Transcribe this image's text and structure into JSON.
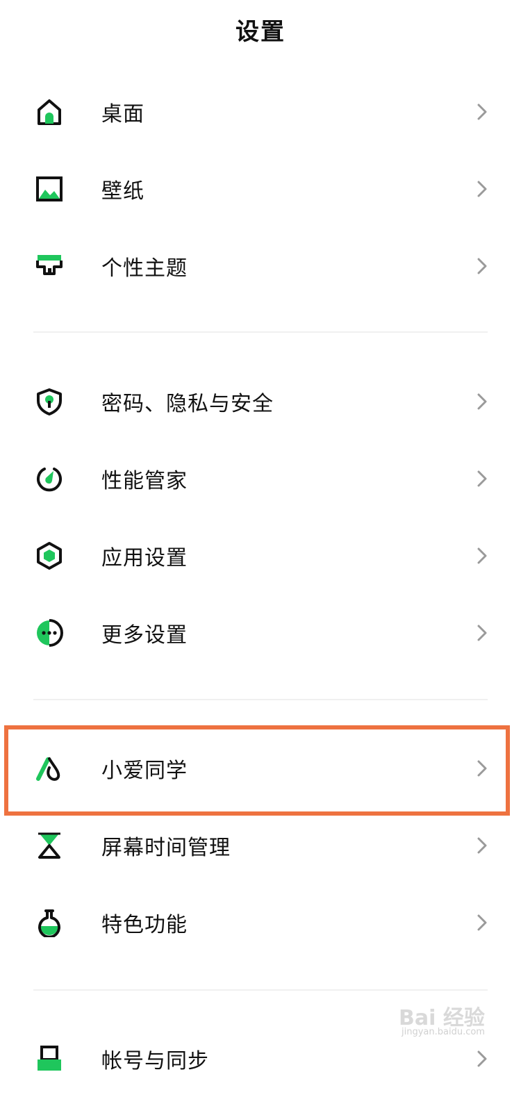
{
  "header": {
    "title": "设置"
  },
  "colors": {
    "accent": "#1fc65c",
    "highlight": "#ee7240",
    "chevron": "#9a9a9a"
  },
  "groups": [
    {
      "items": [
        {
          "label": "桌面",
          "icon": "home-icon"
        },
        {
          "label": "壁纸",
          "icon": "wallpaper-icon"
        },
        {
          "label": "个性主题",
          "icon": "theme-brush-icon"
        }
      ]
    },
    {
      "items": [
        {
          "label": "密码、隐私与安全",
          "icon": "shield-lock-icon"
        },
        {
          "label": "性能管家",
          "icon": "performance-gauge-icon"
        },
        {
          "label": "应用设置",
          "icon": "hexagon-app-icon"
        },
        {
          "label": "更多设置",
          "icon": "more-dots-icon"
        }
      ]
    },
    {
      "items": [
        {
          "label": "小爱同学",
          "icon": "xiaoai-assistant-icon",
          "highlighted": true
        },
        {
          "label": "屏幕时间管理",
          "icon": "hourglass-icon"
        },
        {
          "label": "特色功能",
          "icon": "flask-icon"
        }
      ]
    },
    {
      "items": [
        {
          "label": "帐号与同步",
          "icon": "account-sync-icon"
        }
      ]
    }
  ],
  "watermark": {
    "brand": "Bai 经验",
    "sub": "jingyan.baidu.com"
  }
}
